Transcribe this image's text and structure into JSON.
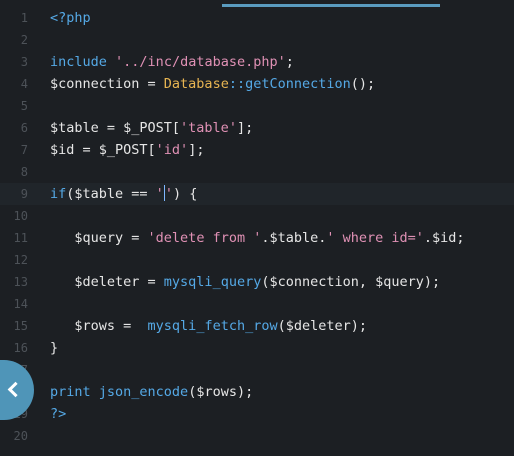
{
  "editor": {
    "lines": [
      {
        "number": "1",
        "code": "<?php"
      },
      {
        "number": "2",
        "code": ""
      },
      {
        "number": "3",
        "code": "include '../inc/database.php';"
      },
      {
        "number": "4",
        "code": "$connection = Database::getConnection();"
      },
      {
        "number": "5",
        "code": ""
      },
      {
        "number": "6",
        "code": "$table = $_POST['table'];"
      },
      {
        "number": "7",
        "code": "$id = $_POST['id'];"
      },
      {
        "number": "8",
        "code": ""
      },
      {
        "number": "9",
        "code": "if($table == '') {"
      },
      {
        "number": "10",
        "code": ""
      },
      {
        "number": "11",
        "code": "   $query = 'delete from '.$table.' where id='.$id;"
      },
      {
        "number": "12",
        "code": ""
      },
      {
        "number": "13",
        "code": "   $deleter = mysqli_query($connection, $query);"
      },
      {
        "number": "14",
        "code": ""
      },
      {
        "number": "15",
        "code": "   $rows =  mysqli_fetch_row($deleter);"
      },
      {
        "number": "16",
        "code": "}"
      },
      {
        "number": "17",
        "code": ""
      },
      {
        "number": "18",
        "code": "print json_encode($rows);"
      },
      {
        "number": "19",
        "code": "?>"
      },
      {
        "number": "20",
        "code": ""
      }
    ]
  },
  "icons": {
    "collapse": "chevron-left-icon"
  },
  "colors": {
    "background": "#1c1f23",
    "keyword": "#55a9e6",
    "string": "#e091b5",
    "class": "#e8b552",
    "accent": "#4f95b8"
  }
}
